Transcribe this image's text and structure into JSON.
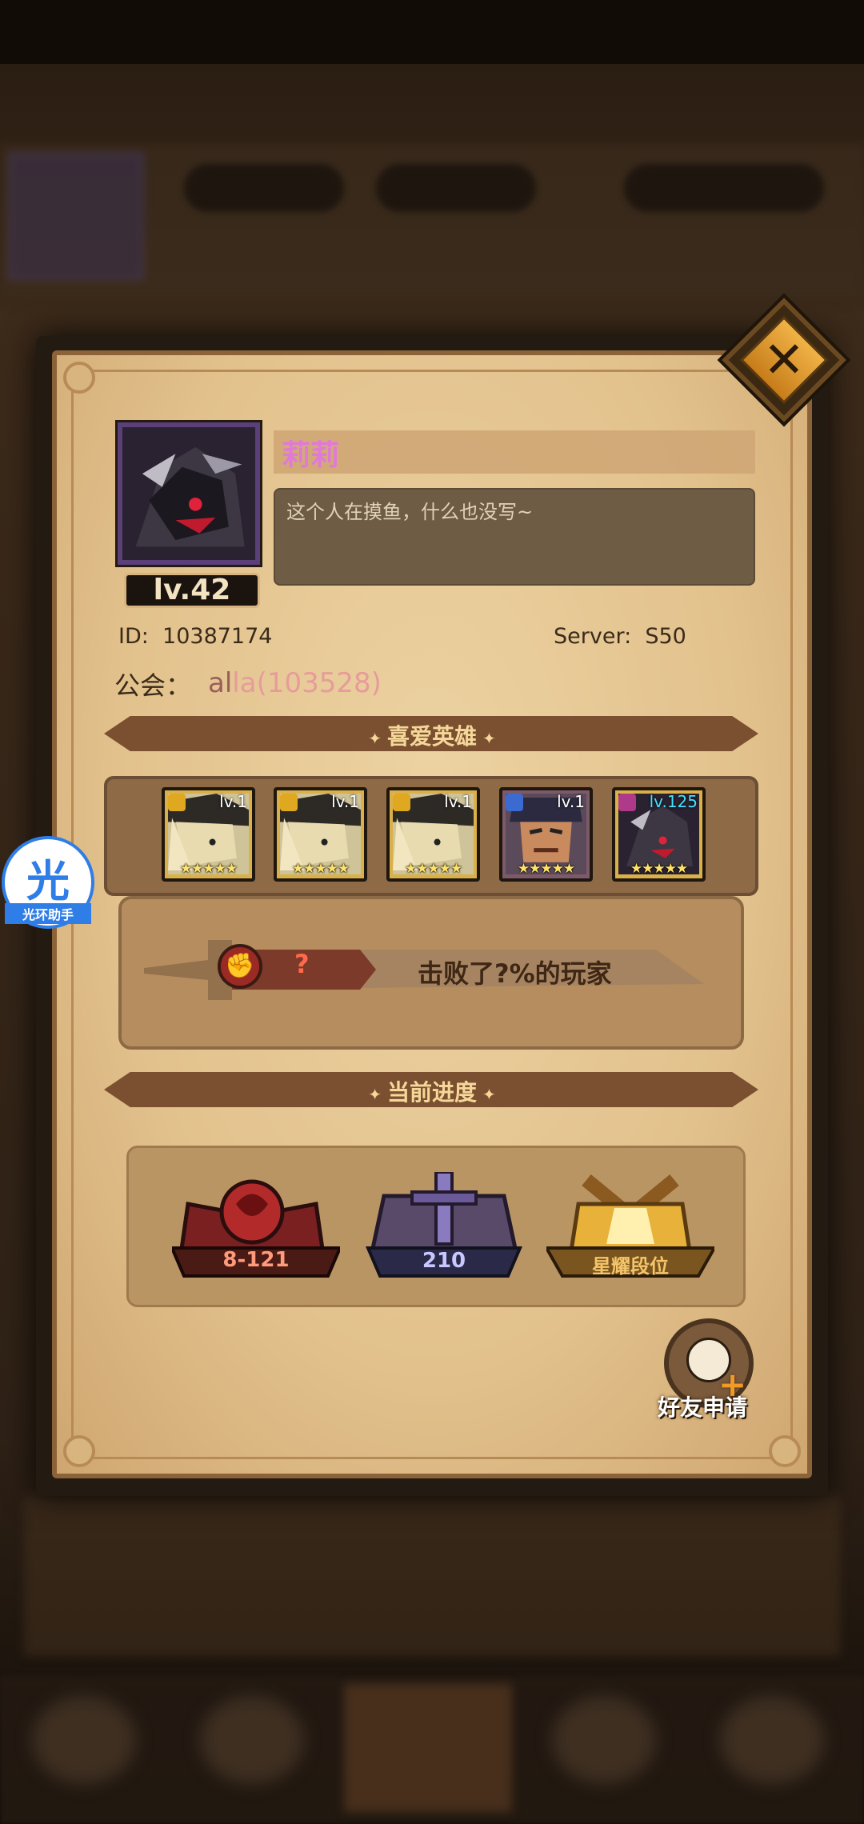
{
  "profile": {
    "name": "莉莉",
    "signature": "这个人在摸鱼，什么也没写~",
    "level": "lv.42",
    "id_label": "ID:",
    "id_value": "10387174",
    "server_label": "Server:",
    "server_value": "S50",
    "guild_label": "公会：",
    "guild_value_prefix": "al",
    "guild_value_rest": "la(103528)"
  },
  "favorite_heroes": {
    "title": "喜爱英雄",
    "heroes": [
      {
        "level": "lv.1",
        "stars": "★★★★★"
      },
      {
        "level": "lv.1",
        "stars": "★★★★★"
      },
      {
        "level": "lv.1",
        "stars": "★★★★★"
      },
      {
        "level": "lv.1",
        "stars": "★★★★★"
      },
      {
        "level": "lv.125",
        "stars": "★★★★★"
      }
    ]
  },
  "ranking": {
    "rank_value": "?",
    "defeat_text": "击败了?%的玩家"
  },
  "progress": {
    "title": "当前进度",
    "items": [
      {
        "label": "8-121"
      },
      {
        "label": "210"
      },
      {
        "label": "星耀段位"
      }
    ]
  },
  "actions": {
    "friend_request": "好友申请",
    "close": "✕"
  },
  "assistant": {
    "glyph": "光",
    "label": "光环助手"
  }
}
